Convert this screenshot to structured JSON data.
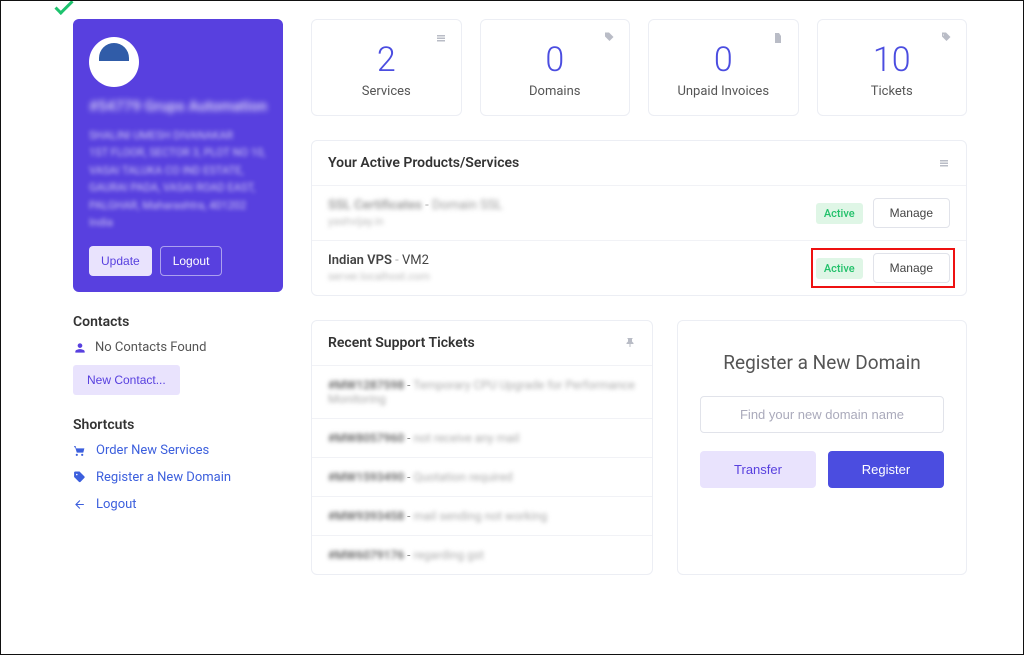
{
  "profile": {
    "name": "#54779 Grups Automation",
    "address_lines": [
      "SHALINI UMESH DIVANAKAR",
      "1ST FLOOR, SECTOR 3, PLOT NO 10,",
      "VASAI TALUKA CO IND ESTATE,",
      "GAURAI PADA, VASAI ROAD EAST,",
      "PALGHAR, Maharashtra, 401202",
      "India"
    ],
    "update_label": "Update",
    "logout_label": "Logout"
  },
  "contacts": {
    "heading": "Contacts",
    "empty_text": "No Contacts Found",
    "new_contact_label": "New Contact..."
  },
  "shortcuts": {
    "heading": "Shortcuts",
    "items": [
      "Order New Services",
      "Register a New Domain",
      "Logout"
    ]
  },
  "stats": [
    {
      "value": "2",
      "label": "Services"
    },
    {
      "value": "0",
      "label": "Domains"
    },
    {
      "value": "0",
      "label": "Unpaid Invoices"
    },
    {
      "value": "10",
      "label": "Tickets"
    }
  ],
  "active_products": {
    "heading": "Your Active Products/Services",
    "rows": [
      {
        "name": "SSL Certificates",
        "suffix": "Domain SSL",
        "sub": "yashvijay.in",
        "status": "Active",
        "manage": "Manage",
        "blur_name": true,
        "highlight": false
      },
      {
        "name": "Indian VPS",
        "suffix": "VM2",
        "sub": "server.localhost.com",
        "status": "Active",
        "manage": "Manage",
        "blur_name": false,
        "highlight": true
      }
    ]
  },
  "tickets": {
    "heading": "Recent Support Tickets",
    "rows": [
      {
        "id": "#MW1287598",
        "subject": "Temporary CPU Upgrade for Performance Monitoring"
      },
      {
        "id": "#MW8057960",
        "subject": "not receive any mail"
      },
      {
        "id": "#MW1593490",
        "subject": "Quotation required"
      },
      {
        "id": "#MW9393458",
        "subject": "mail sending not working"
      },
      {
        "id": "#MW6079176",
        "subject": "regarding gst"
      }
    ]
  },
  "domain": {
    "title": "Register a New Domain",
    "placeholder": "Find your new domain name",
    "transfer_label": "Transfer",
    "register_label": "Register"
  }
}
